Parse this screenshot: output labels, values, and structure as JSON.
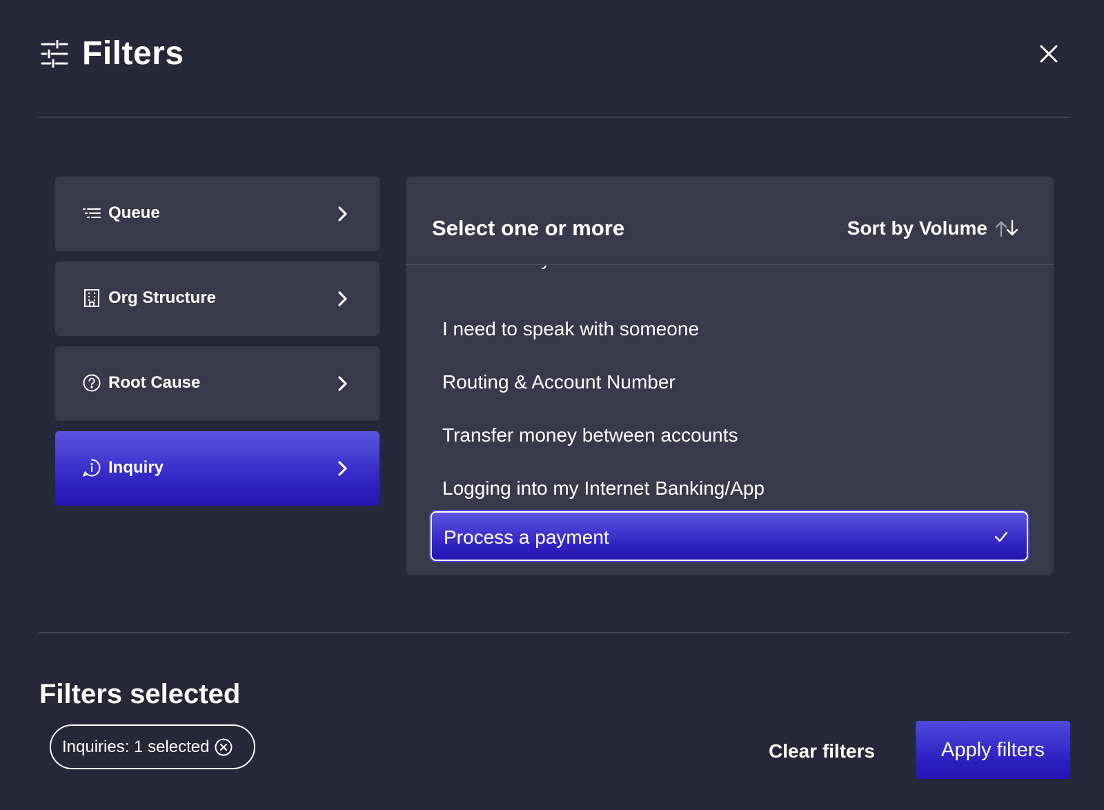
{
  "header": {
    "title": "Filters",
    "icon": "sliders-icon",
    "close_icon": "close-icon"
  },
  "categories": [
    {
      "label": "Queue",
      "icon": "list-icon",
      "active": false
    },
    {
      "label": "Org Structure",
      "icon": "building-icon",
      "active": false
    },
    {
      "label": "Root Cause",
      "icon": "question-circle-icon",
      "active": false
    },
    {
      "label": "Inquiry",
      "icon": "info-circle-icon",
      "active": true
    }
  ],
  "panel": {
    "title": "Select one or more",
    "sort_label": "Sort by Volume",
    "sort_icon": "sort-arrows-icon",
    "options": [
      {
        "label": "Fraud on my account",
        "selected": false
      },
      {
        "label": "I need to speak with someone",
        "selected": false
      },
      {
        "label": "Routing & Account Number",
        "selected": false
      },
      {
        "label": "Transfer money between accounts",
        "selected": false
      },
      {
        "label": "Logging into my Internet Banking/App",
        "selected": false
      },
      {
        "label": "Process a payment",
        "selected": true
      }
    ]
  },
  "footer": {
    "title": "Filters selected",
    "chip_label": "Inquiries: 1 selected",
    "clear_label": "Clear filters",
    "apply_label": "Apply filters"
  },
  "colors": {
    "background": "#242838",
    "card": "#363a4a",
    "accent": "#2f22c2",
    "accent_light": "#5a55e0"
  }
}
